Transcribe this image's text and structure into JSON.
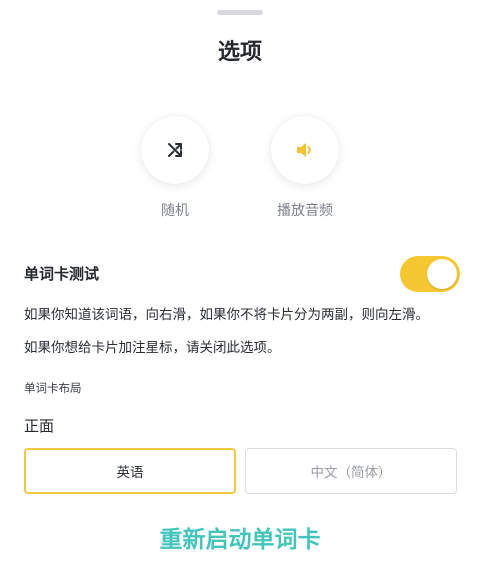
{
  "sheet": {
    "title": "选项"
  },
  "actions": {
    "shuffle": {
      "label": "随机",
      "icon": "shuffle-icon"
    },
    "play_audio": {
      "label": "播放音频",
      "icon": "speaker-icon",
      "icon_color": "#f1c232"
    }
  },
  "flashcard_test": {
    "title": "单词卡测试",
    "enabled": true,
    "toggle_color": "#f5c832",
    "description_1": "如果你知道该词语，向右滑，如果你不将卡片分为两副，则向左滑。",
    "description_2": "如果你想给卡片加注星标，请关闭此选项。"
  },
  "card_layout": {
    "section_label": "单词卡布局",
    "side_label": "正面",
    "options": [
      {
        "label": "英语",
        "selected": true
      },
      {
        "label": "中文（简体）",
        "selected": false
      }
    ],
    "selected_color": "#f2c744"
  },
  "restart": {
    "label": "重新启动单词卡",
    "color": "#45c4bb"
  }
}
